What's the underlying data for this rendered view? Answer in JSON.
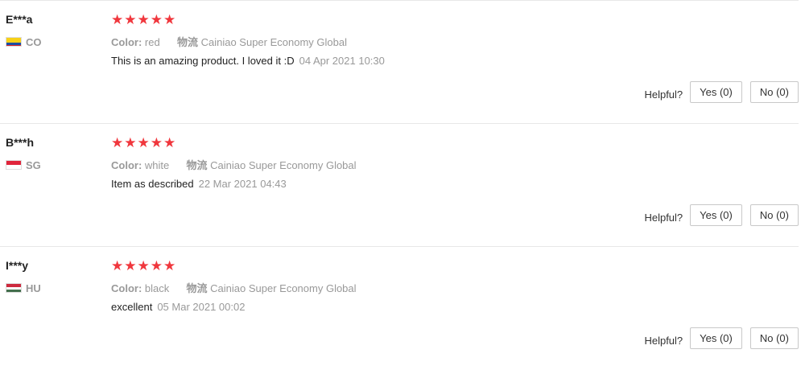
{
  "reviews": [
    {
      "name": "E***a",
      "country": "CO",
      "flag_colors": [
        "#f7d117",
        "#f7d117",
        "#1d4fa3",
        "#d31f2a"
      ],
      "stars": "★★★★★",
      "color_label": "Color:",
      "color_value": "red",
      "logistics_label": "物流",
      "logistics_value": "Cainiao Super Economy Global",
      "text": "This is an amazing product. I loved it :D",
      "date": "04 Apr 2021 10:30",
      "helpful_label": "Helpful?",
      "yes_label": "Yes (0)",
      "no_label": "No (0)"
    },
    {
      "name": "B***h",
      "country": "SG",
      "flag_colors": [
        "#e0243b",
        "#ffffff"
      ],
      "stars": "★★★★★",
      "color_label": "Color:",
      "color_value": "white",
      "logistics_label": "物流",
      "logistics_value": "Cainiao Super Economy Global",
      "text": "Item as described",
      "date": "22 Mar 2021 04:43",
      "helpful_label": "Helpful?",
      "yes_label": "Yes (0)",
      "no_label": "No (0)"
    },
    {
      "name": "I***y",
      "country": "HU",
      "flag_colors": [
        "#cd2a3e",
        "#ffffff",
        "#436f4d"
      ],
      "stars": "★★★★★",
      "color_label": "Color:",
      "color_value": "black",
      "logistics_label": "物流",
      "logistics_value": "Cainiao Super Economy Global",
      "text": "excellent",
      "date": "05 Mar 2021 00:02",
      "helpful_label": "Helpful?",
      "yes_label": "Yes (0)",
      "no_label": "No (0)"
    }
  ],
  "rating": 5,
  "colors": {
    "star": "#f0373d",
    "muted": "#999999",
    "text": "#222222"
  }
}
